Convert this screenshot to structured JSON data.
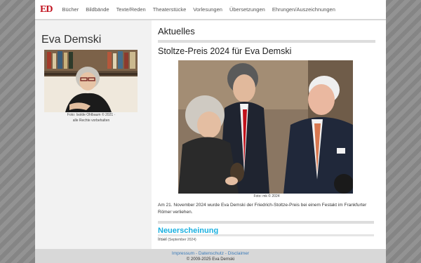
{
  "nav": {
    "logo": "ED",
    "items": [
      "Bücher",
      "Bildbände",
      "Texte/Reden",
      "Theaterstücke",
      "Vorlesungen",
      "Übersetzungen",
      "Ehrungen/Auszeichnungen"
    ]
  },
  "sidebar": {
    "title": "Eva Demski",
    "caption_line1": "Foto: Isolde Ohlbaum © 2021 ·",
    "caption_line2": "alle Rechte vorbehalten"
  },
  "main": {
    "section_title": "Aktuelles",
    "headline": "Stoltze-Preis 2024 für Eva Demski",
    "photo_caption": "Foto: mk © 2024",
    "body": "Am 21. November 2024 wurde Eva Demski der Friedrich-Stoltze-Preis bei einem Festakt im Frankfurter Römer verliehen.",
    "sub_title": "Neuerscheinung",
    "item": "Insel",
    "item_date": "(September 2024)"
  },
  "footer": {
    "impressum": "Impressum",
    "sep1": " - ",
    "datenschutz": "Datenschutz",
    "sep2": " - ",
    "disclaimer": "Disclaimer",
    "copyright": "© 2009-2025 Eva Demski"
  },
  "colors": {
    "logo": "#c1121f",
    "accent": "#1ab0e0",
    "link": "#3a7ab8"
  }
}
